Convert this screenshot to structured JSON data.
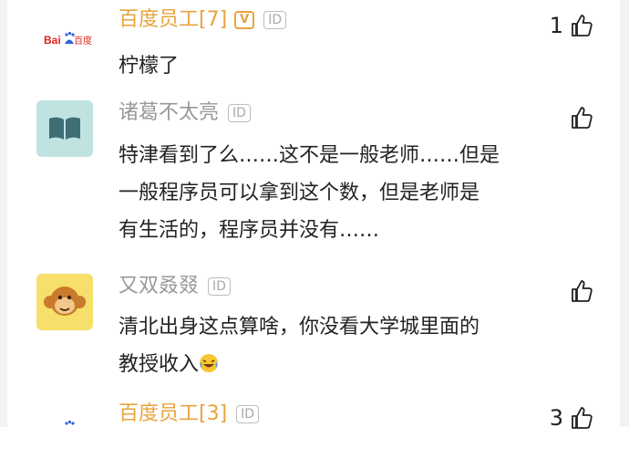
{
  "comments": [
    {
      "user": "百度员工[7]",
      "verified_badge": "V",
      "id_badge": "ID",
      "text_lines": [
        "柠檬了"
      ],
      "likes": "1",
      "avatar_logo": "Bai百度"
    },
    {
      "user": "诸葛不太亮",
      "id_badge": "ID",
      "text_lines": [
        "特津看到了么……这不是一般老师……但是",
        "一般程序员可以拿到这个数，但是老师是",
        "有生活的，程序员并没有……"
      ],
      "likes": ""
    },
    {
      "user": "又双叒叕",
      "id_badge": "ID",
      "text_lines": [
        "清北出身这点算啥，你没看大学城里面的",
        "教授收入"
      ],
      "likes": ""
    },
    {
      "user": "百度员工[3]",
      "id_badge": "ID",
      "likes": "3"
    }
  ],
  "icons": {
    "like": "thumbs-up-icon",
    "emoji": "laughing-tears-emoji"
  },
  "colors": {
    "vip_name": "#e8a33d",
    "plain_name": "#999999",
    "text": "#222222"
  }
}
